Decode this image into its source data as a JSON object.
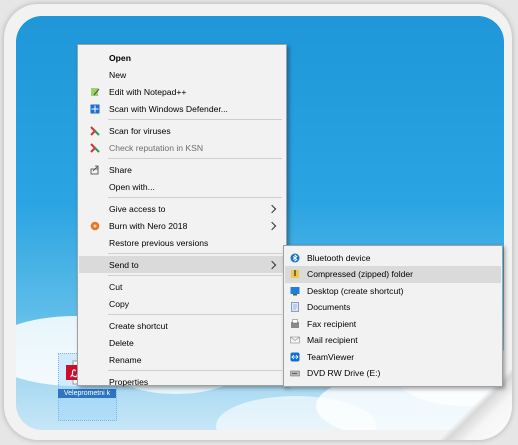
{
  "context_menu": {
    "groups": [
      [
        {
          "label": "Open",
          "bold": true,
          "icon": ""
        },
        {
          "label": "New",
          "icon": ""
        },
        {
          "label": "Edit with Notepad++",
          "icon": "notepadpp-icon"
        },
        {
          "label": "Scan with Windows Defender...",
          "icon": "windows-defender-icon"
        }
      ],
      [
        {
          "label": "Scan for viruses",
          "icon": "kaspersky-icon"
        },
        {
          "label": "Check reputation in KSN",
          "icon": "kaspersky-icon",
          "disabled": true
        }
      ],
      [
        {
          "label": "Share",
          "icon": "share-icon"
        },
        {
          "label": "Open with...",
          "icon": ""
        }
      ],
      [
        {
          "label": "Give access to",
          "icon": "",
          "submenu": true
        },
        {
          "label": "Burn with Nero 2018",
          "icon": "nero-icon",
          "submenu": true
        },
        {
          "label": "Restore previous versions",
          "icon": ""
        }
      ],
      [
        {
          "label": "Send to",
          "icon": "",
          "submenu": true,
          "highlighted": true
        }
      ],
      [
        {
          "label": "Cut",
          "icon": ""
        },
        {
          "label": "Copy",
          "icon": ""
        }
      ],
      [
        {
          "label": "Create shortcut",
          "icon": ""
        },
        {
          "label": "Delete",
          "icon": ""
        },
        {
          "label": "Rename",
          "icon": ""
        }
      ],
      [
        {
          "label": "Properties",
          "icon": ""
        }
      ]
    ]
  },
  "send_to_menu": {
    "items": [
      {
        "label": "Bluetooth device",
        "icon": "bluetooth-icon"
      },
      {
        "label": "Compressed (zipped) folder",
        "icon": "zip-folder-icon",
        "highlighted": true
      },
      {
        "label": "Desktop (create shortcut)",
        "icon": "desktop-icon"
      },
      {
        "label": "Documents",
        "icon": "documents-icon"
      },
      {
        "label": "Fax recipient",
        "icon": "fax-icon"
      },
      {
        "label": "Mail recipient",
        "icon": "mail-icon"
      },
      {
        "label": "TeamViewer",
        "icon": "teamviewer-icon"
      },
      {
        "label": "DVD RW Drive (E:)",
        "icon": "dvd-drive-icon"
      }
    ]
  },
  "desktop_file": {
    "name": "Veleprometni k"
  },
  "colors": {
    "desktop_top": "#1f97d8",
    "menu_bg": "#f2f2f2",
    "highlight": "#dadada"
  }
}
